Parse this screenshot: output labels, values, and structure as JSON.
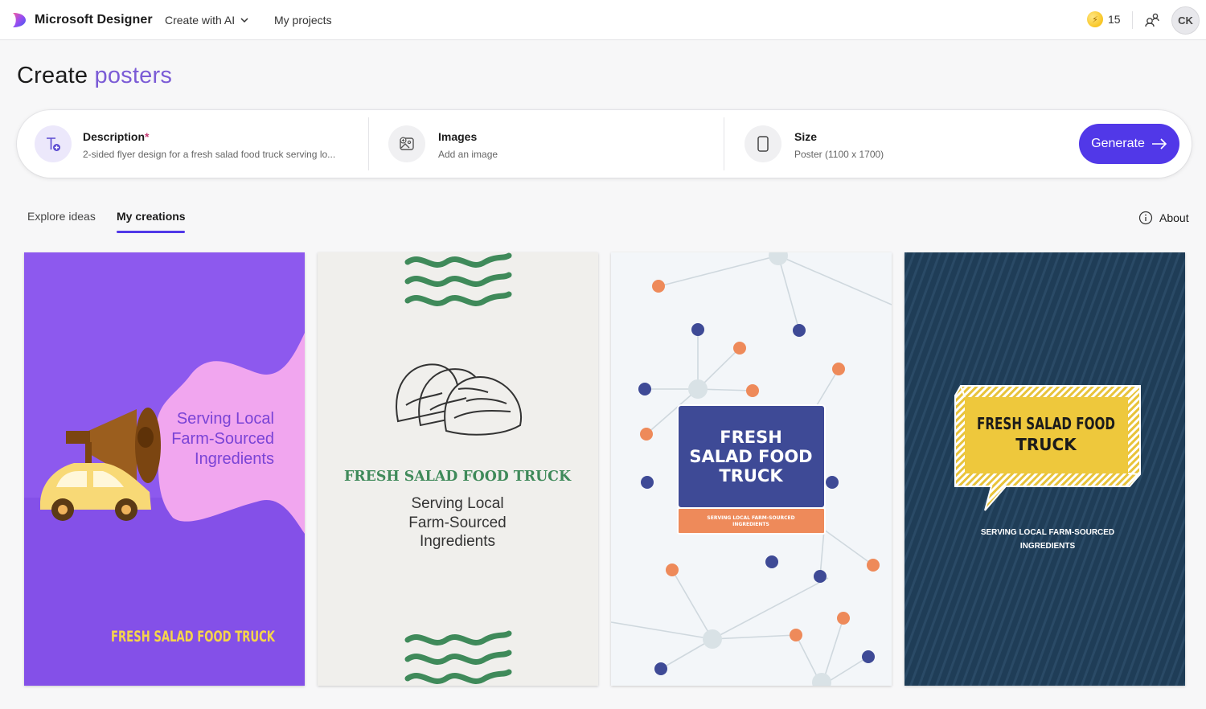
{
  "app": {
    "brand": "Microsoft Designer",
    "nav": {
      "create_with_ai": "Create with AI",
      "my_projects": "My projects"
    },
    "credits": "15",
    "avatar_initials": "CK"
  },
  "page": {
    "title_prefix": "Create",
    "title_accent": "posters"
  },
  "prompt": {
    "description": {
      "label": "Description",
      "required_mark": "*",
      "value": "2-sided flyer design for a fresh salad food truck serving lo..."
    },
    "images": {
      "label": "Images",
      "value": "Add an image"
    },
    "size": {
      "label": "Size",
      "value": "Poster (1100 x 1700)"
    },
    "generate_label": "Generate"
  },
  "tabs": [
    {
      "label": "Explore ideas",
      "active": false
    },
    {
      "label": "My creations",
      "active": true
    }
  ],
  "about_label": "About",
  "colors": {
    "accent": "#5138e8",
    "title_accent": "#7b5bd6"
  },
  "cards": [
    {
      "heading": "FRESH SALAD FOOD TRUCK",
      "lines": [
        "Serving Local",
        "Farm-Sourced",
        "Ingredients"
      ],
      "bg": "#8f5cf0"
    },
    {
      "heading": "FRESH SALAD FOOD TRUCK",
      "lines": [
        "Serving Local",
        "Farm-Sourced",
        "Ingredients"
      ],
      "bg": "#f0efec"
    },
    {
      "heading_lines": [
        "FRESH",
        "SALAD FOOD",
        "TRUCK"
      ],
      "sub_lines": [
        "SERVING LOCAL FARM-SOURCED",
        "INGREDIENTS"
      ],
      "bg": "#f3f6f9"
    },
    {
      "heading_lines": [
        "FRESH SALAD FOOD",
        "TRUCK"
      ],
      "sub_lines": [
        "SERVING LOCAL FARM-SOURCED",
        "INGREDIENTS"
      ],
      "bg": "#1f3d57"
    }
  ]
}
